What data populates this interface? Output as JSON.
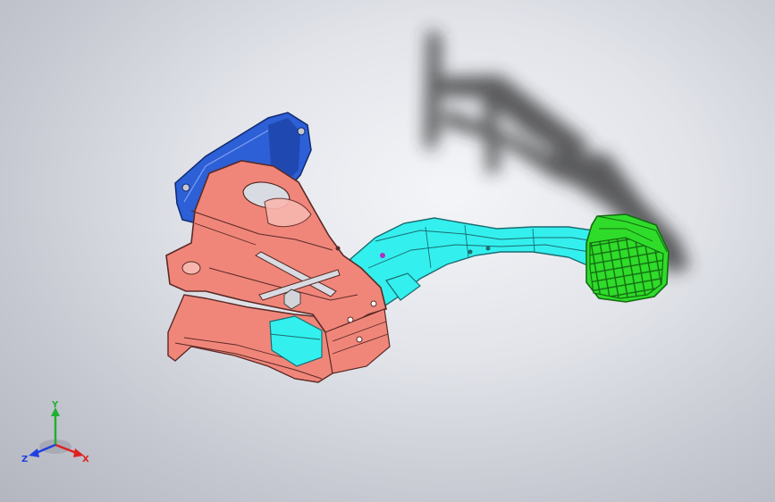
{
  "viewport": {
    "colors": {
      "bracket": "#f0867a",
      "bracket_edge": "#5a2a26",
      "mount_plate": "#2d5fd6",
      "lever_arm": "#33f0ee",
      "lever_edge": "#1b6b70",
      "pedal_pad": "#2fdc2a",
      "pad_edge": "#146b12",
      "shadow": "#2b2b2b"
    }
  },
  "triad": {
    "x_label": "X",
    "y_label": "Y",
    "z_label": "Z",
    "colors": {
      "x": "#e02020",
      "y": "#20b030",
      "z": "#2040e0"
    }
  }
}
